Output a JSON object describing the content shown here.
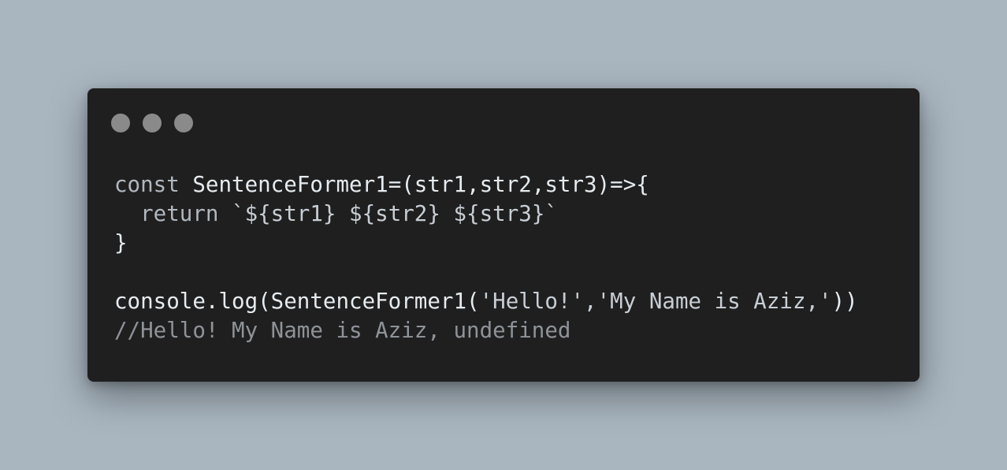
{
  "window": {
    "title_controls": [
      "close",
      "minimize",
      "zoom"
    ]
  },
  "code": {
    "lines": [
      {
        "tokens": [
          {
            "text": "const ",
            "type": "keyword"
          },
          {
            "text": "SentenceFormer1=(str1,str2,str3)=>{",
            "type": "identifier"
          }
        ]
      },
      {
        "tokens": [
          {
            "text": "  return ",
            "type": "keyword"
          },
          {
            "text": "`${str1} ${str2} ${str3}`",
            "type": "string"
          }
        ]
      },
      {
        "tokens": [
          {
            "text": "}",
            "type": "identifier"
          }
        ]
      },
      {
        "tokens": []
      },
      {
        "tokens": [
          {
            "text": "console.log(SentenceFormer1(",
            "type": "identifier"
          },
          {
            "text": "'Hello!','My Name is Aziz,'",
            "type": "string"
          },
          {
            "text": "))",
            "type": "identifier"
          }
        ]
      },
      {
        "tokens": [
          {
            "text": "//Hello! My Name is Aziz, undefined",
            "type": "comment"
          }
        ]
      }
    ]
  },
  "colors": {
    "background": "#a9b6c0",
    "window": "#1f1f1f",
    "dot": "#8a8a8a"
  }
}
